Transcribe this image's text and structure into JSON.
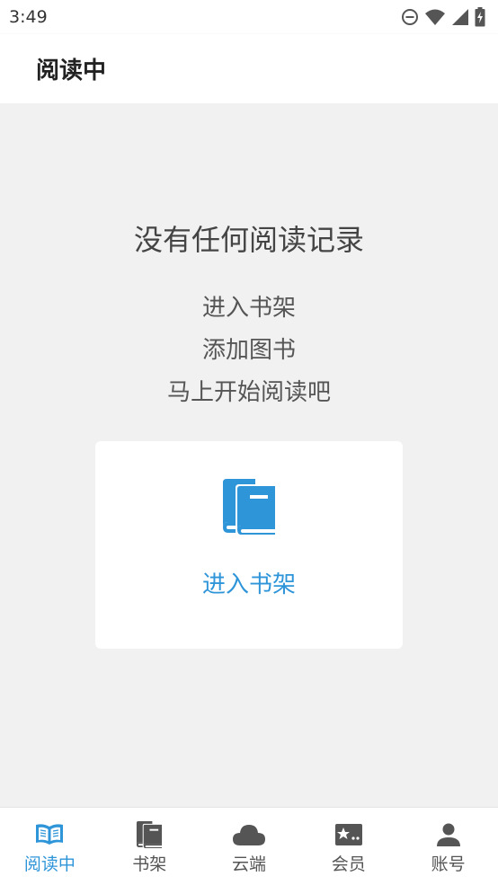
{
  "status_bar": {
    "time": "3:49"
  },
  "header": {
    "title": "阅读中"
  },
  "empty_state": {
    "title": "没有任何阅读记录",
    "lines": [
      "进入书架",
      "添加图书",
      "马上开始阅读吧"
    ]
  },
  "shelf_card": {
    "label": "进入书架",
    "icon": "books-icon"
  },
  "bottom_nav": {
    "items": [
      {
        "label": "阅读中",
        "icon": "open-book-icon",
        "active": true
      },
      {
        "label": "书架",
        "icon": "books-icon",
        "active": false
      },
      {
        "label": "云端",
        "icon": "cloud-icon",
        "active": false
      },
      {
        "label": "会员",
        "icon": "member-card-icon",
        "active": false
      },
      {
        "label": "账号",
        "icon": "person-icon",
        "active": false
      }
    ]
  },
  "colors": {
    "accent": "#2f95d9",
    "nav_inactive": "#555555",
    "background": "#f1f1f1"
  }
}
